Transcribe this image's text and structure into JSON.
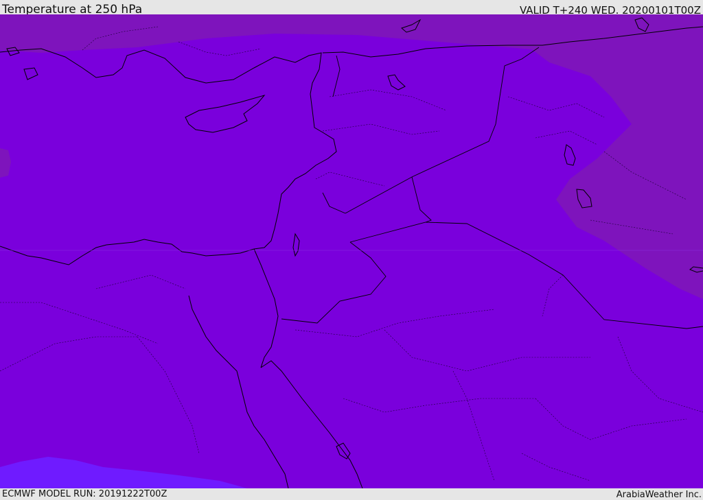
{
  "header": {
    "title": "Temperature at 250 hPa",
    "valid": "VALID T+240 WED. 20200101T00Z"
  },
  "footer": {
    "model_run": "ECMWF MODEL RUN: 20191222T00Z",
    "credit": "ArabiaWeather Inc."
  },
  "map": {
    "colors": {
      "main_field": "#7a00dc",
      "cool_field": "#7e14bc",
      "warm_field": "#6f1bff",
      "coastline": "#000000"
    },
    "region": "Eastern Mediterranean and Middle East"
  }
}
